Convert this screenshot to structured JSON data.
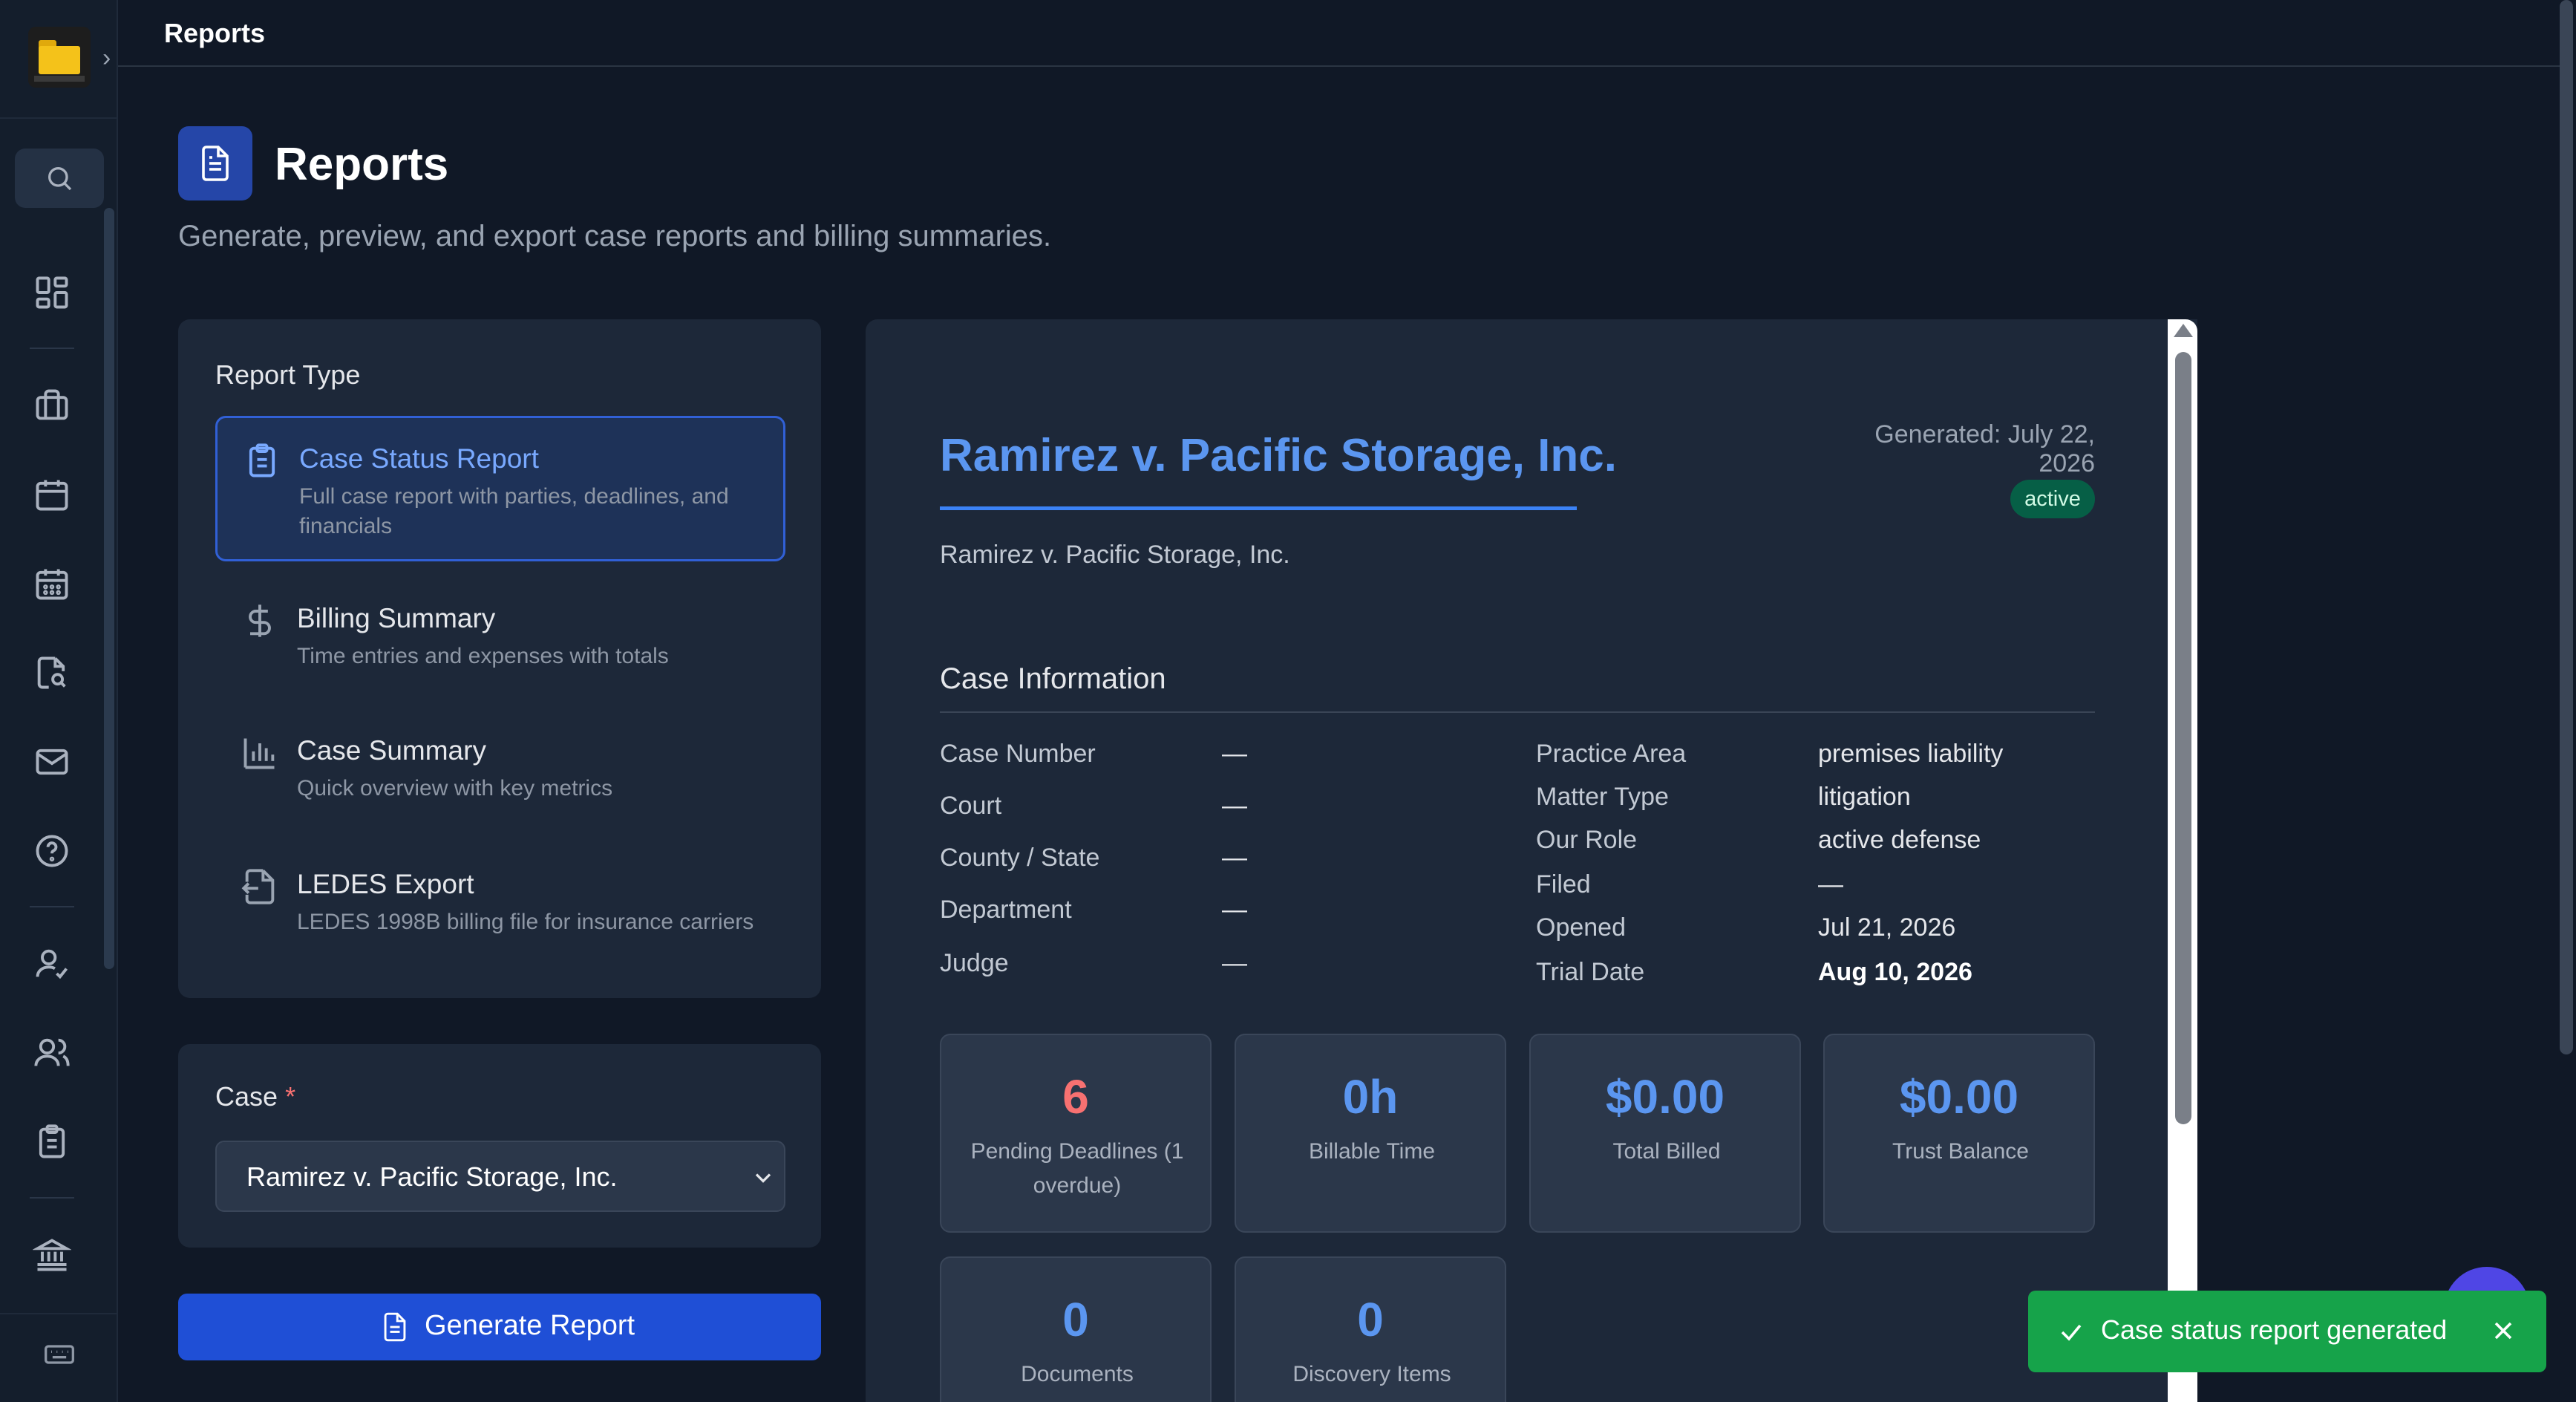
{
  "topbar": {
    "title": "Reports"
  },
  "page": {
    "title": "Reports",
    "subtitle": "Generate, preview, and export case reports and billing summaries."
  },
  "sidebar": {
    "icons": [
      "dashboard-icon",
      "briefcase-icon",
      "calendar-icon",
      "calendar-grid-icon",
      "file-search-icon",
      "mail-icon",
      "help-icon",
      "user-check-icon",
      "users-icon",
      "clipboard-icon",
      "bank-icon",
      "keyboard-icon"
    ]
  },
  "report_type": {
    "label": "Report Type",
    "items": [
      {
        "title": "Case Status Report",
        "desc": "Full case report with parties, deadlines, and financials",
        "icon": "clipboard-icon"
      },
      {
        "title": "Billing Summary",
        "desc": "Time entries and expenses with totals",
        "icon": "dollar-icon"
      },
      {
        "title": "Case Summary",
        "desc": "Quick overview with key metrics",
        "icon": "bar-chart-icon"
      },
      {
        "title": "LEDES Export",
        "desc": "LEDES 1998B billing file for insurance carriers",
        "icon": "file-export-icon"
      }
    ]
  },
  "case_select": {
    "label": "Case",
    "required": "*",
    "value": "Ramirez v. Pacific Storage, Inc."
  },
  "generate_button": {
    "label": "Generate Report"
  },
  "preview": {
    "case_title": "Ramirez v. Pacific Storage, Inc.",
    "generated": "Generated: July 22, 2026",
    "status": "active",
    "case_subtitle": "Ramirez v. Pacific Storage, Inc.",
    "section_title": "Case Information",
    "left_info": [
      {
        "label": "Case Number",
        "value": "—"
      },
      {
        "label": "Court",
        "value": "—"
      },
      {
        "label": "County / State",
        "value": "—"
      },
      {
        "label": "Department",
        "value": "—"
      },
      {
        "label": "Judge",
        "value": "—"
      }
    ],
    "right_info": [
      {
        "label": "Practice Area",
        "value": "premises liability"
      },
      {
        "label": "Matter Type",
        "value": "litigation"
      },
      {
        "label": "Our Role",
        "value": "active defense"
      },
      {
        "label": "Filed",
        "value": "—"
      },
      {
        "label": "Opened",
        "value": "Jul 21, 2026"
      },
      {
        "label": "Trial Date",
        "value": "Aug 10, 2026"
      }
    ],
    "stats": [
      {
        "value": "6",
        "label": "Pending Deadlines (1 overdue)"
      },
      {
        "value": "0h",
        "label": "Billable Time"
      },
      {
        "value": "$0.00",
        "label": "Total Billed"
      },
      {
        "value": "$0.00",
        "label": "Trust Balance"
      },
      {
        "value": "0",
        "label": "Documents"
      },
      {
        "value": "0",
        "label": "Discovery Items"
      }
    ]
  },
  "toast": {
    "message": "Case status report generated"
  },
  "colors": {
    "background": "#101826",
    "panel": "#1d2839",
    "accent": "#1f4fd6",
    "link_blue": "#5b96f0",
    "success": "#16a34a",
    "danger": "#f87171"
  }
}
